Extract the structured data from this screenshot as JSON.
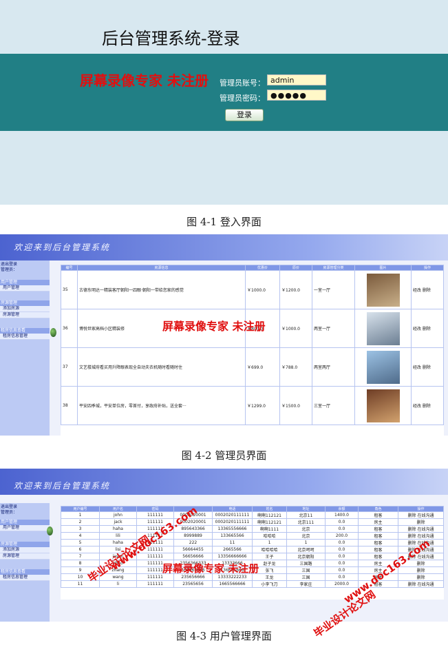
{
  "fig1": {
    "title": "后台管理系统-登录",
    "account_label": "管理员账号：",
    "password_label": "管理员密码：",
    "account_value": "admin",
    "password_value": "●●●●●",
    "login_button": "登录",
    "caption": "图 4-1  登入界面"
  },
  "fig2": {
    "header_title": "欢迎来到后台管理系统",
    "caption": "图  4-2  管理员界面",
    "columns": [
      "编号",
      "房源信息",
      "优惠价",
      "原价",
      "房源管理分类",
      "图片",
      "操作"
    ],
    "rows": [
      {
        "id": "35",
        "info": "古德东明达一精装客厅朝阳一四眼·朝阳一带给您家的感觉",
        "sale": "￥1000.0",
        "price": "￥1200.0",
        "type": "一室一厅",
        "ops": "经改  删除"
      },
      {
        "id": "36",
        "info": "博悦世家高档小区精装修",
        "sale": "￥800.0",
        "price": "￥1000.0",
        "type": "两室一厅",
        "ops": "经改  删除"
      },
      {
        "id": "37",
        "info": "文艺楼城府看买用升降眼表现全自动夫衣机随时看随时住",
        "sale": "￥699.0",
        "price": "￥788.0",
        "type": "两室两厅",
        "ops": "经改  删除"
      },
      {
        "id": "38",
        "info": "平安四季城，平安单位房，零首付，享政府补贴，送全套···",
        "sale": "￥1299.0",
        "price": "￥1500.0",
        "type": "三室一厅",
        "ops": "经改  删除"
      }
    ]
  },
  "fig3": {
    "header_title": "欢迎来到后台管理系统",
    "caption": "图  4-3  用户管理界面",
    "columns": [
      "用户编号",
      "用户名",
      "密码",
      "电话",
      "姓名",
      "地址",
      "余额",
      "角色",
      "操作"
    ],
    "rows": [
      {
        "id": "1",
        "user": "john",
        "pwd": "111111",
        "phone": "0002020001",
        "tel": "0002020111111",
        "name": "啊啊112121",
        "addr": "北京11",
        "bal": "1400.0",
        "role": "租客",
        "ops": "删除  在线沟通"
      },
      {
        "id": "2",
        "user": "jack",
        "pwd": "111111",
        "phone": "0002020001",
        "tel": "0002020111111",
        "name": "啊啊112121",
        "addr": "北京111",
        "bal": "0.0",
        "role": "房主",
        "ops": "删除"
      },
      {
        "id": "3",
        "user": "haha",
        "pwd": "111111",
        "phone": "895643366",
        "tel": "13365556666",
        "name": "啊啊1111",
        "addr": "北京",
        "bal": "0.0",
        "role": "租客",
        "ops": "删除  在线沟通"
      },
      {
        "id": "4",
        "user": "lili",
        "pwd": "111111",
        "phone": "8999889",
        "tel": "133665566",
        "name": "哈哈哈",
        "addr": "北京",
        "bal": "200.0",
        "role": "租客",
        "ops": "删除  在线沟通"
      },
      {
        "id": "5",
        "user": "haha",
        "pwd": "111111",
        "phone": "222",
        "tel": "11",
        "name": "1",
        "addr": "1",
        "bal": "0.0",
        "role": "租客",
        "ops": "删除  在线沟通"
      },
      {
        "id": "6",
        "user": "lisi",
        "pwd": "111111",
        "phone": "56664455",
        "tel": "2665566",
        "name": "哈哈哈哈",
        "addr": "北京呵呵",
        "bal": "0.0",
        "role": "租客",
        "ops": "删除  在线沟通"
      },
      {
        "id": "7",
        "user": "jason",
        "pwd": "111111",
        "phone": "56656666",
        "tel": "13356666666",
        "name": "王子",
        "addr": "北京朝阳",
        "bal": "0.0",
        "role": "租客",
        "ops": "删除  在线沟通"
      },
      {
        "id": "8",
        "user": "zhao",
        "pwd": "111111",
        "phone": "2356366333",
        "tel": "13333666",
        "name": "赵子龙",
        "addr": "三国路",
        "bal": "0.0",
        "role": "房主",
        "ops": "删除"
      },
      {
        "id": "9",
        "user": "zhang",
        "pwd": "111111",
        "phone": "568966666",
        "tel": "136655666",
        "name": "张飞",
        "addr": "三国",
        "bal": "0.0",
        "role": "房主",
        "ops": "删除"
      },
      {
        "id": "10",
        "user": "wang",
        "pwd": "111111",
        "phone": "235656666",
        "tel": "13333222233",
        "name": "王龙",
        "addr": "三国",
        "bal": "0.0",
        "role": "房主",
        "ops": "删除"
      },
      {
        "id": "11",
        "user": "li",
        "pwd": "111111",
        "phone": "23565656",
        "tel": "1665566666",
        "name": "小李飞刀",
        "addr": "李家庄",
        "bal": "2000.0",
        "role": "租客",
        "ops": "删除  在线沟通"
      }
    ]
  },
  "sidebar": {
    "g0": "退出登录",
    "g0b": "管理员：",
    "g1": "用户管理",
    "g1a": "用户管理",
    "g2": "房源管理",
    "g2a": "添加房源",
    "g2b": "房源管理",
    "g3": "租房信息查看",
    "g3a": "租房信息管理"
  },
  "watermarks": {
    "recorder": "屏幕录像专家  未注册",
    "site": "www.doc163.com",
    "label": "毕业设计论文网"
  },
  "colors": {
    "login_band": "#217f85",
    "header": "#4c63d0",
    "sidebar": "#bccaf4",
    "table_head": "#7f97e6",
    "watermark": "#e01010"
  }
}
